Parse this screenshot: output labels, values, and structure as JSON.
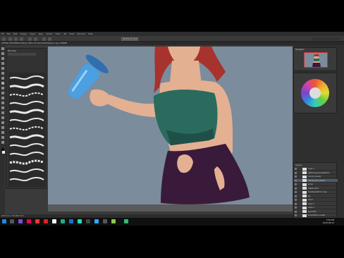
{
  "window": {
    "menu": [
      "PS",
      "File",
      "Edit",
      "Image",
      "Layer",
      "Type",
      "Select",
      "Filter",
      "3D",
      "View",
      "Window",
      "Help"
    ],
    "option_select": "Sample All Layers",
    "document_tab": "CHARLI WIP REDACLAN @ 100% (brush/chesthelp/up copy, RGB/8)"
  },
  "brush_panel": {
    "title": "Brushes",
    "stroke_count": 13
  },
  "navigator": {
    "title": "Navigator"
  },
  "layers": {
    "title": "Layers",
    "rows": [
      "Layer 1",
      "default_greyscale/texture",
      "cloudy_shadow",
      "shading_skin_hands",
      "group",
      "clipped_face",
      "forest/grassfront_copy",
      "bg",
      "cloud",
      "Layer 1",
      "Layer 1",
      "layer/face",
      "brushtexture_lineart",
      "layerstrokes_bodyfill_grey"
    ]
  },
  "status": {
    "text": "100%   Doc: 30.0M/2.57G"
  },
  "taskbar": {
    "time": "3:58 PM",
    "date": "2018-08-14"
  },
  "colors": {
    "canvas_bg": "#7b8c9d",
    "top_color": "#2a6b5e",
    "skirt_color": "#3a1a3a",
    "skin_color": "#e3b092",
    "hair_color": "#a8322e",
    "bottle_color": "#4aa0e0"
  }
}
